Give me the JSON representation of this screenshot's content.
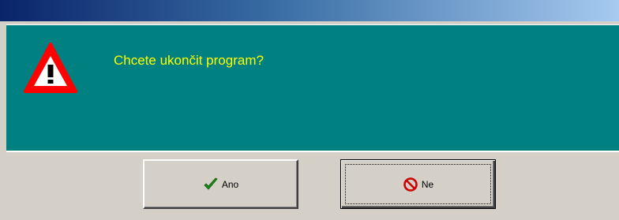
{
  "dialog": {
    "message": "Chcete ukončit program?",
    "icon": "warning-triangle-icon"
  },
  "buttons": {
    "yes": {
      "label": "Ano",
      "icon": "checkmark-icon",
      "icon_color": "#1a8a1a"
    },
    "no": {
      "label": "Ne",
      "icon": "no-entry-icon",
      "icon_color": "#cc0000"
    }
  },
  "colors": {
    "titlebar_start": "#0a246a",
    "titlebar_end": "#a6caf0",
    "content_bg": "#008080",
    "message_text": "#ffff00",
    "warning_red": "#ff0000",
    "face": "#d4d0c8"
  }
}
